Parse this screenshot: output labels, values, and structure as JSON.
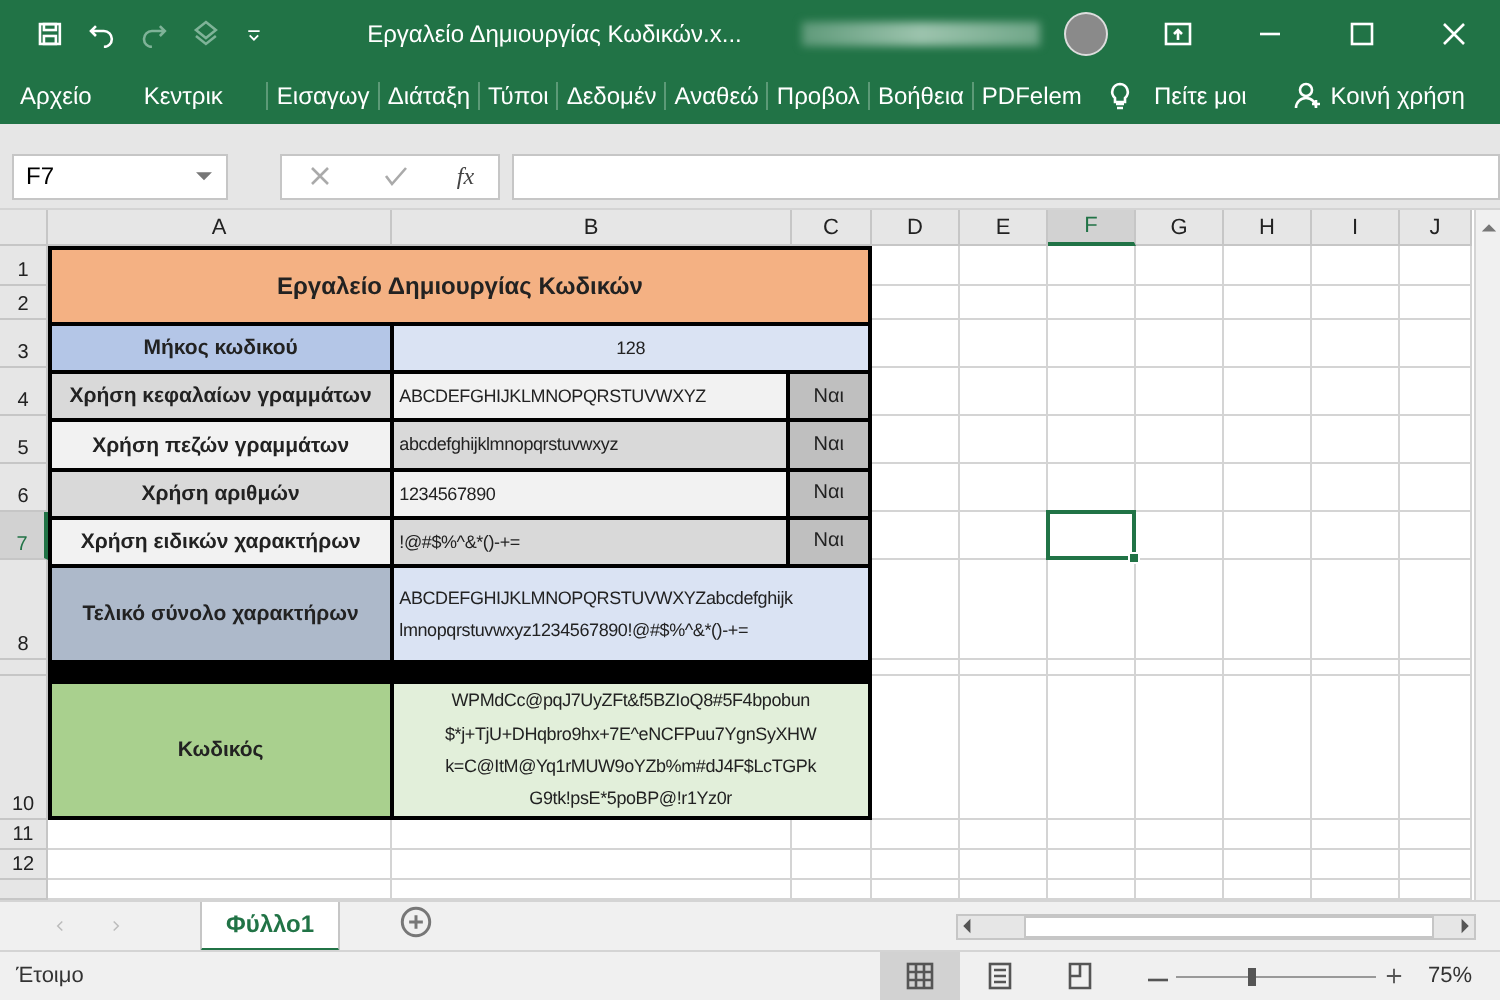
{
  "window": {
    "title": "Εργαλείο Δημιουργίας Κωδικών.x..."
  },
  "ribbon": {
    "tabs": [
      {
        "label": "Αρχείο"
      },
      {
        "label": "Κεντρικ"
      },
      {
        "label": "Εισαγωγ"
      },
      {
        "label": "Διάταξη"
      },
      {
        "label": "Τύποι"
      },
      {
        "label": "Δεδομέν"
      },
      {
        "label": "Αναθεώ"
      },
      {
        "label": "Προβολ"
      },
      {
        "label": "Βοήθεια"
      },
      {
        "label": "PDFelem"
      }
    ],
    "tell_me": "Πείτε μοι",
    "share": "Κοινή χρήση"
  },
  "formula_bar": {
    "name_box": "F7",
    "fx": "fx"
  },
  "sheet": {
    "columns": [
      {
        "label": "A",
        "selected": false
      },
      {
        "label": "B",
        "selected": false
      },
      {
        "label": "C",
        "selected": false
      },
      {
        "label": "D",
        "selected": false
      },
      {
        "label": "E",
        "selected": false
      },
      {
        "label": "F",
        "selected": true
      },
      {
        "label": "G",
        "selected": false
      },
      {
        "label": "H",
        "selected": false
      },
      {
        "label": "I",
        "selected": false
      },
      {
        "label": "J",
        "selected": false
      }
    ],
    "rows": [
      {
        "label": "1",
        "selected": false
      },
      {
        "label": "2",
        "selected": false
      },
      {
        "label": "3",
        "selected": false
      },
      {
        "label": "4",
        "selected": false
      },
      {
        "label": "5",
        "selected": false
      },
      {
        "label": "6",
        "selected": false
      },
      {
        "label": "7",
        "selected": true
      },
      {
        "label": "8",
        "selected": false
      },
      {
        "selected": false
      },
      {
        "label": "10",
        "selected": false
      },
      {
        "label": "11",
        "selected": false
      },
      {
        "label": "12",
        "selected": false
      },
      {
        "selected": false
      }
    ],
    "table": {
      "title": "Εργαλείο Δημιουργίας Κωδικών",
      "rows": [
        {
          "kind": "length",
          "label": "Μήκος κωδικού",
          "value_lines": [
            "128"
          ]
        },
        {
          "kind": "option",
          "label": "Χρήση κεφαλαίων γραμμάτων",
          "value_lines": [
            "ABCDEFGHIJKLMNOPQRSTUVWXYZ"
          ],
          "answer": "Ναι"
        },
        {
          "kind": "option",
          "label": "Χρήση πεζών γραμμάτων",
          "value_lines": [
            "abcdefghijklmnopqrstuvwxyz"
          ],
          "answer": "Ναι"
        },
        {
          "kind": "option",
          "label": "Χρήση αριθμών",
          "value_lines": [
            "1234567890"
          ],
          "answer": "Ναι"
        },
        {
          "kind": "option",
          "label": "Χρήση ειδικών χαρακτήρων",
          "value_lines": [
            "!@#$%^&*()-+="
          ],
          "answer": "Ναι"
        },
        {
          "kind": "total",
          "label": "Τελικό σύνολο χαρακτήρων",
          "value_lines": [
            "ABCDEFGHIJKLMNOPQRSTUVWXYZabcdefghijk",
            "lmnopqrstuvwxyz1234567890!@#$%^&*()-+="
          ]
        },
        {
          "kind": "password",
          "label": "Κωδικός",
          "value_lines": [
            "WPMdCc@pqJ7UyZFt&f5BZIoQ8#5F4bpobun",
            "$*j+TjU+DHqbro9hx+7E^eNCFPuu7YgnSyXHW",
            "k=C@ItM@Yq1rMUW9oYZb%m#dJ4F$LcTGPk",
            "G9tk!psE*5poBP@!r1Yz0r"
          ]
        }
      ]
    }
  },
  "sheet_tabs": [
    {
      "label": "Φύλλο1",
      "selected": true
    }
  ],
  "status_bar": {
    "status": "Έτοιμο",
    "views": [
      {
        "kind": "normal",
        "selected": true
      },
      {
        "kind": "page_layout",
        "selected": false
      },
      {
        "kind": "page_break",
        "selected": false
      }
    ],
    "zoom": {
      "level": 0.38,
      "reading": "75%"
    }
  }
}
